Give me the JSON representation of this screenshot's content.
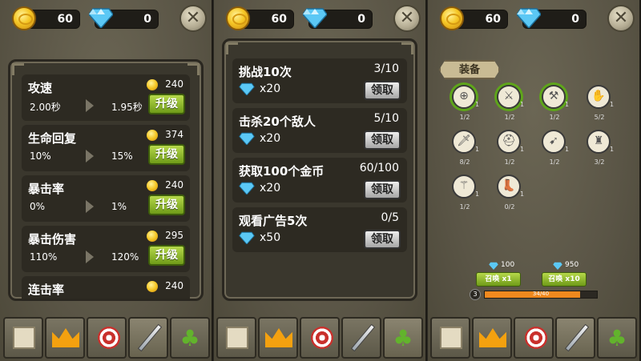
{
  "panels": [
    {
      "coins": "60",
      "gems": "0"
    },
    {
      "coins": "60",
      "gems": "0"
    },
    {
      "coins": "60",
      "gems": "0"
    }
  ],
  "upgrades": [
    {
      "name": "攻速",
      "cost": "240",
      "current": "2.00秒",
      "next": "1.95秒",
      "button": "升级"
    },
    {
      "name": "生命回复",
      "cost": "374",
      "current": "10%",
      "next": "15%",
      "button": "升级"
    },
    {
      "name": "暴击率",
      "cost": "240",
      "current": "0%",
      "next": "1%",
      "button": "升级"
    },
    {
      "name": "暴击伤害",
      "cost": "295",
      "current": "110%",
      "next": "120%",
      "button": "升级"
    },
    {
      "name": "连击率",
      "cost": "240",
      "current": "",
      "next": "",
      "button": ""
    }
  ],
  "quests": [
    {
      "name": "挑战10次",
      "progress": "3/10",
      "reward": "x20",
      "button": "领取"
    },
    {
      "name": "击杀20个敌人",
      "progress": "5/10",
      "reward": "x20",
      "button": "领取"
    },
    {
      "name": "获取100个金币",
      "progress": "60/100",
      "reward": "x20",
      "button": "领取"
    },
    {
      "name": "观看广告5次",
      "progress": "0/5",
      "reward": "x50",
      "button": "领取"
    }
  ],
  "equipment": {
    "title": "装备",
    "slots": [
      {
        "icon": "compass-icon",
        "glyph": "⊕",
        "level": "1",
        "count": "1/2",
        "highlight": true
      },
      {
        "icon": "dagger-icon",
        "glyph": "⚔",
        "level": "1",
        "count": "1/2",
        "highlight": true
      },
      {
        "icon": "hammer-icon",
        "glyph": "⚒",
        "level": "1",
        "count": "1/2",
        "highlight": true
      },
      {
        "icon": "gloves-icon",
        "glyph": "✋",
        "level": "1",
        "count": "5/2",
        "highlight": false
      },
      {
        "icon": "sword-icon",
        "glyph": "🗡",
        "level": "1",
        "count": "8/2",
        "highlight": false
      },
      {
        "icon": "helmet-icon",
        "glyph": "⛑",
        "level": "1",
        "count": "1/2",
        "highlight": false
      },
      {
        "icon": "bow-icon",
        "glyph": "➹",
        "level": "1",
        "count": "1/2",
        "highlight": false
      },
      {
        "icon": "armor-icon",
        "glyph": "♜",
        "level": "1",
        "count": "3/2",
        "highlight": false
      },
      {
        "icon": "wand-icon",
        "glyph": "⚚",
        "level": "1",
        "count": "1/2",
        "highlight": false
      },
      {
        "icon": "boots-icon",
        "glyph": "👢",
        "level": "1",
        "count": "0/2",
        "highlight": false
      }
    ],
    "summon1": {
      "cost": "100",
      "label": "召唤 x1"
    },
    "summon10": {
      "cost": "950",
      "label": "召唤 x10"
    },
    "level": "3",
    "xp_text": "34/40",
    "xp_fraction": 0.85
  },
  "colors": {
    "accent_green": "#6f9b18",
    "gold": "#f6c726",
    "gem": "#5bc8f5",
    "xp": "#f0891e"
  }
}
